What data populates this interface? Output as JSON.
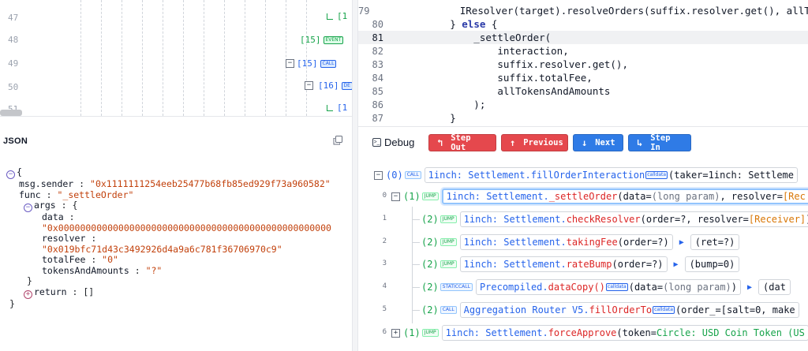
{
  "trace": {
    "line_numbers": [
      "47",
      "48",
      "49",
      "50",
      "51"
    ],
    "nodes": [
      {
        "label": "[1"
      },
      {
        "label": "[15]",
        "badge": "EVENT"
      },
      {
        "label": "[15]",
        "badge": "CALL"
      },
      {
        "label": "[16]",
        "badge": "DE"
      },
      {
        "label": "[1"
      }
    ]
  },
  "json_panel": {
    "title": "JSON",
    "copy_icon": "copy-icon",
    "lines": {
      "open": "{",
      "sender_key": "msg.sender",
      "sender_val": "\"0x1111111254eeb25477b68fb85ed929f73a960582\"",
      "func_key": "func",
      "func_val": "\"_settleOrder\"",
      "args_key": "args",
      "args_open": "{",
      "data_key": "data",
      "data_val": "\"0x00000000000000000000000000000000000000000000000000",
      "resolver_key": "resolver",
      "resolver_val": "\"0x019bfc71d43c3492926d4a9a6c781f36706970c9\"",
      "totalfee_key": "totalFee",
      "totalfee_val": "\"0\"",
      "tokens_key": "tokensAndAmounts",
      "tokens_val": "\"?\"",
      "args_close": "}",
      "return_key": "return",
      "return_val": "[]",
      "close": "}"
    }
  },
  "code": {
    "lines": [
      {
        "num": "79",
        "text": "            IResolver(target).resolveOrders(suffix.resolver.get(), allToken"
      },
      {
        "num": "80",
        "pre": "        } ",
        "kw": "else",
        "post": " {"
      },
      {
        "num": "81",
        "text": "            _settleOrder(",
        "active": true
      },
      {
        "num": "82",
        "text": "                interaction,"
      },
      {
        "num": "83",
        "text": "                suffix.resolver.get(),"
      },
      {
        "num": "84",
        "text": "                suffix.totalFee,"
      },
      {
        "num": "85",
        "text": "                allTokensAndAmounts"
      },
      {
        "num": "86",
        "text": "            );"
      },
      {
        "num": "87",
        "text": "        }"
      }
    ]
  },
  "debug": {
    "title": "Debug",
    "buttons": {
      "step_out": "Step Out",
      "previous": "Previous",
      "next": "Next",
      "step_in": "Step In"
    }
  },
  "tree": {
    "root": {
      "depth": "(0)",
      "badge": "CALL",
      "contract": "1inch: Settlement.",
      "method": "fillOrderInteraction",
      "badge2": "calldata",
      "args": "(taker=1inch: Settleme"
    },
    "rows": [
      {
        "idx": "0",
        "depth": "(1)",
        "badge": "JUMP",
        "contract": "1inch: Settlement.",
        "method": "_settleOrder",
        "args_a": "(data=",
        "args_p": "(long param)",
        "args_b": ", resolver=",
        "args_r": "[Rec"
      },
      {
        "idx": "1",
        "depth": "(2)",
        "badge": "JUMP",
        "contract": "1inch: Settlement.",
        "method": "checkResolver",
        "args_a": "(order=?, resolver=",
        "args_r": "[Receiver]",
        "args_b": ")"
      },
      {
        "idx": "2",
        "depth": "(2)",
        "badge": "JUMP",
        "contract": "1inch: Settlement.",
        "method": "takingFee",
        "args_a": "(order=?)",
        "ret": "(ret=?)"
      },
      {
        "idx": "3",
        "depth": "(2)",
        "badge": "JUMP",
        "contract": "1inch: Settlement.",
        "method": "rateBump",
        "args_a": "(order=?)",
        "ret": "(bump=0)"
      },
      {
        "idx": "4",
        "depth": "(2)",
        "badge": "STATICCALL",
        "contract": "Precompiled.",
        "method": "dataCopy()",
        "badge2": "calldata",
        "args_a": "(data=",
        "args_p": "(long param)",
        "args_b": ")",
        "ret": "(dat"
      },
      {
        "idx": "5",
        "depth": "(2)",
        "badge": "CALL",
        "contract": "Aggregation Router V5.",
        "method": "fillOrderTo",
        "badge2": "calldata",
        "args_a": "(order_=[salt=0, make"
      },
      {
        "idx": "6",
        "depth": "(1)",
        "badge": "JUMP",
        "contract": "1inch: Settlement.",
        "method": "forceApprove",
        "args_a": "(token=",
        "args_c": "Circle: USD Coin Token (US"
      }
    ]
  }
}
